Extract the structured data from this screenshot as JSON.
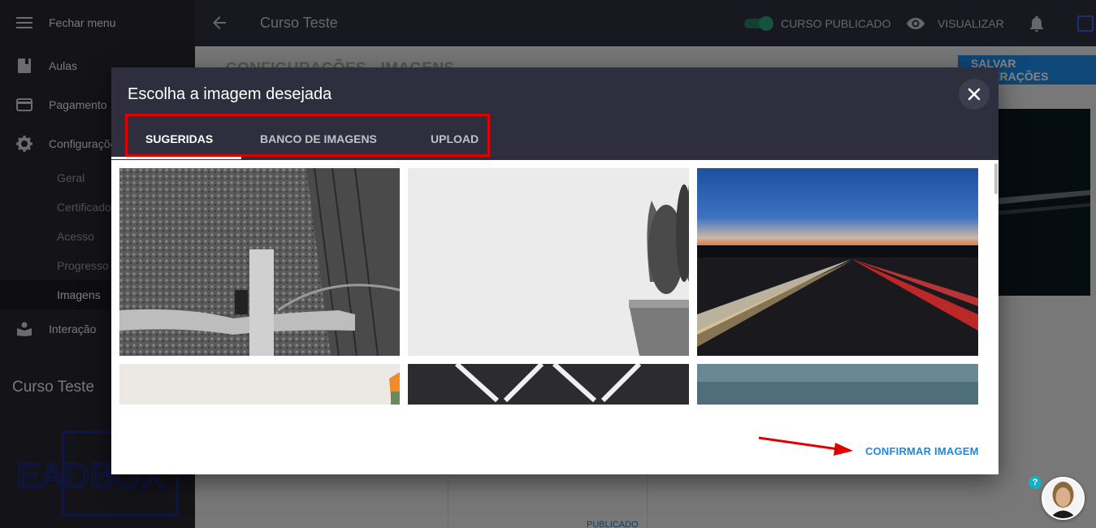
{
  "sidebar": {
    "close_menu": "Fechar menu",
    "items": {
      "aulas": "Aulas",
      "pagamento": "Pagamento",
      "configuracoes": "Configurações",
      "interacao": "Interação"
    },
    "sub_items": {
      "geral": "Geral",
      "certificado": "Certificado",
      "acesso": "Acesso",
      "progresso": "Progresso",
      "imagens": "Imagens"
    },
    "course_name": "Curso Teste",
    "logo_text": "EADBOX"
  },
  "topbar": {
    "title": "Curso Teste",
    "published_label": "CURSO PUBLICADO",
    "view_label": "VISUALIZAR"
  },
  "page": {
    "heading": "CONFIGURAÇÕES - IMAGENS",
    "save_button": "SALVAR ALTERAÇÕES",
    "card_status": "PUBLICADO"
  },
  "modal": {
    "title": "Escolha a imagem desejada",
    "tabs": {
      "suggested": "SUGERIDAS",
      "bank": "BANCO DE IMAGENS",
      "upload": "UPLOAD"
    },
    "active_tab": "SUGERIDAS",
    "confirm_button": "CONFIRMAR IMAGEM"
  },
  "help": {
    "label": "?"
  },
  "colors": {
    "sidebar_bg": "#25252f",
    "topbar_bg": "#2e2e3e",
    "accent_blue": "#1e88e5",
    "highlight_red": "#e00000",
    "toggle_green": "#26a17a"
  }
}
